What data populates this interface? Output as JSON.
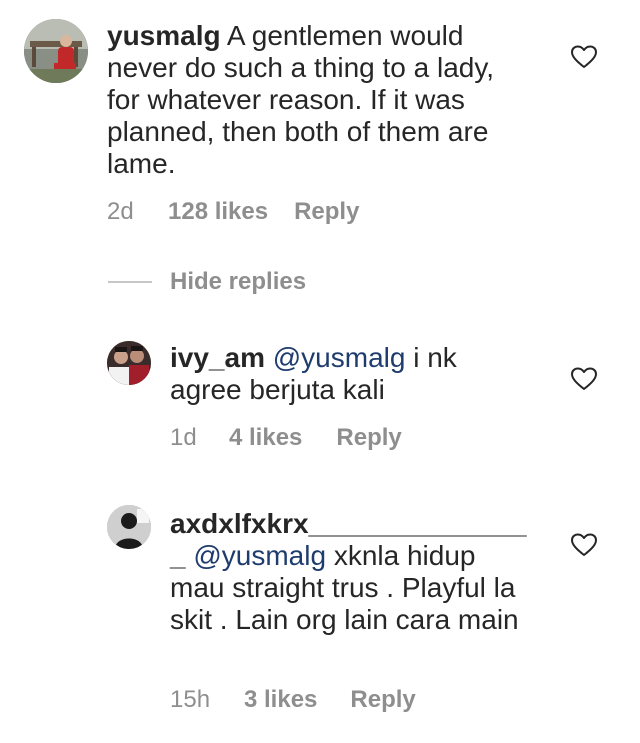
{
  "comments": [
    {
      "username": "yusmalg",
      "mention": "",
      "text": "A gentlemen would never do such a thing to a lady, for whatever reason. If it was planned, then both of them are lame.",
      "time": "2d",
      "likes": "128 likes",
      "reply": "Reply"
    },
    {
      "username": "ivy_am",
      "mention": "@yusmalg",
      "text": "i nk agree berjuta kali",
      "time": "1d",
      "likes": "4 likes",
      "reply": "Reply"
    },
    {
      "username": "axdxlfxkrx_______________",
      "mention": "@yusmalg",
      "text": "xknla hidup mau straight trus . Playful la skit . Lain org lain cara main",
      "time": "15h",
      "likes": "3 likes",
      "reply": "Reply"
    }
  ],
  "hide_replies": "Hide replies",
  "icons": {
    "like": "heart-outline-icon"
  },
  "colors": {
    "text": "#262626",
    "muted": "#8e8e8e",
    "mention": "#1f3c6e"
  }
}
